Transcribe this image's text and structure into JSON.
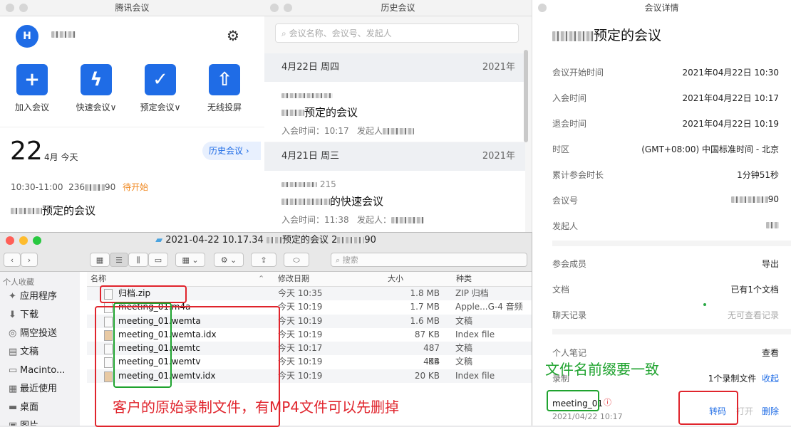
{
  "app": {
    "title": "腾讯会议",
    "avatar_letter": "H",
    "actions": [
      {
        "icon": "plus-icon",
        "label": "加入会议"
      },
      {
        "icon": "lightning-icon",
        "label": "快速会议∨"
      },
      {
        "icon": "calendar-check-icon",
        "label": "预定会议∨"
      },
      {
        "icon": "screen-share-icon",
        "label": "无线投屏"
      }
    ],
    "big_day": "22",
    "month_day": "4月 今天",
    "history_button": "历史会议",
    "meeting_time": "10:30-11:00",
    "meeting_id": "236",
    "meeting_id_tail": "90",
    "meeting_status": "待开始",
    "meeting_title": "预定的会议"
  },
  "history": {
    "title": "历史会议",
    "search_placeholder": "会议名称、会议号、发起人",
    "groups": [
      {
        "day": "4月22日 周四",
        "year": "2021年",
        "title_suffix": "预定的会议",
        "join": "入会时间：10:17",
        "host": "发起人"
      },
      {
        "day": "4月21日 周三",
        "year": "2021年",
        "id_tail": "215",
        "title_suffix": "的快速会议",
        "join": "入会时间：11:38",
        "host": "发起人："
      }
    ]
  },
  "details": {
    "title": "会议详情",
    "meeting_title": "预定的会议",
    "rows": [
      {
        "k": "会议开始时间",
        "v": "2021年04月22日 10:30"
      },
      {
        "k": "入会时间",
        "v": "2021年04月22日 10:17"
      },
      {
        "k": "退会时间",
        "v": "2021年04月22日 10:19"
      },
      {
        "k": "时区",
        "v": "(GMT+08:00) 中国标准时间 - 北京"
      },
      {
        "k": "累计参会时长",
        "v": "1分钟51秒"
      },
      {
        "k": "会议号",
        "v": "90"
      },
      {
        "k": "发起人",
        "v": ""
      }
    ],
    "members_label": "参会成员",
    "members_action": "导出",
    "docs_label": "文档",
    "docs_action": "已有1个文档",
    "chat_label": "聊天记录",
    "chat_value": "无可查看记录",
    "notes_label": "个人笔记",
    "notes_action": "查看",
    "record_label": "录制",
    "record_count": "1个录制文件",
    "record_collapse": "收起",
    "recording": {
      "name": "meeting_01",
      "date": "2021/04/22 10:17",
      "convert": "转码",
      "open": "打开",
      "delete": "删除"
    }
  },
  "finder": {
    "title": "2021-04-22 10.17.34",
    "title_mid": "预定的会议 2",
    "title_tail": "90",
    "search_placeholder": "搜索",
    "sidebar_header": "个人收藏",
    "sidebar": [
      {
        "icon": "applications-icon",
        "glyph": "✦",
        "label": "应用程序"
      },
      {
        "icon": "download-icon",
        "glyph": "⬇",
        "label": "下载"
      },
      {
        "icon": "airdrop-icon",
        "glyph": "◎",
        "label": "隔空投送"
      },
      {
        "icon": "document-icon",
        "glyph": "▤",
        "label": "文稿"
      },
      {
        "icon": "disk-icon",
        "glyph": "▭",
        "label": "Macinto..."
      },
      {
        "icon": "recent-icon",
        "glyph": "▦",
        "label": "最近使用"
      },
      {
        "icon": "desktop-icon",
        "glyph": "▬",
        "label": "桌面"
      },
      {
        "icon": "picture-icon",
        "glyph": "▣",
        "label": "图片"
      }
    ],
    "columns": [
      "名称",
      "修改日期",
      "大小",
      "种类"
    ],
    "files": [
      {
        "name": "归档.zip",
        "date": "今天 10:35",
        "size": "1.8 MB",
        "kind": "ZIP 归档"
      },
      {
        "name": "meeting_01.m4a",
        "date": "今天 10:19",
        "size": "1.7 MB",
        "kind": "Apple...G-4 音频"
      },
      {
        "name": "meeting_01.wemta",
        "date": "今天 10:19",
        "size": "1.6 MB",
        "kind": "文稿"
      },
      {
        "name": "meeting_01.wemta.idx",
        "date": "今天 10:19",
        "size": "87 KB",
        "kind": "Index file"
      },
      {
        "name": "meeting_01.wemtc",
        "date": "今天 10:17",
        "size": "487 KB",
        "kind": "文稿"
      },
      {
        "name": "meeting_01.wemtv",
        "date": "今天 10:19",
        "size": "434 KB",
        "kind": "文稿"
      },
      {
        "name": "meeting_01.wemtv.idx",
        "date": "今天 10:19",
        "size": "20 KB",
        "kind": "Index file"
      }
    ]
  },
  "annotations": {
    "red_text": "客户的原始录制文件，有MP4文件可以先删掉",
    "green_text": "文件名前缀要一致"
  },
  "colors": {
    "accent": "#1f6ce6",
    "pending": "#f08a24",
    "annotation_red": "#e0242c",
    "annotation_green": "#1fa32f"
  }
}
